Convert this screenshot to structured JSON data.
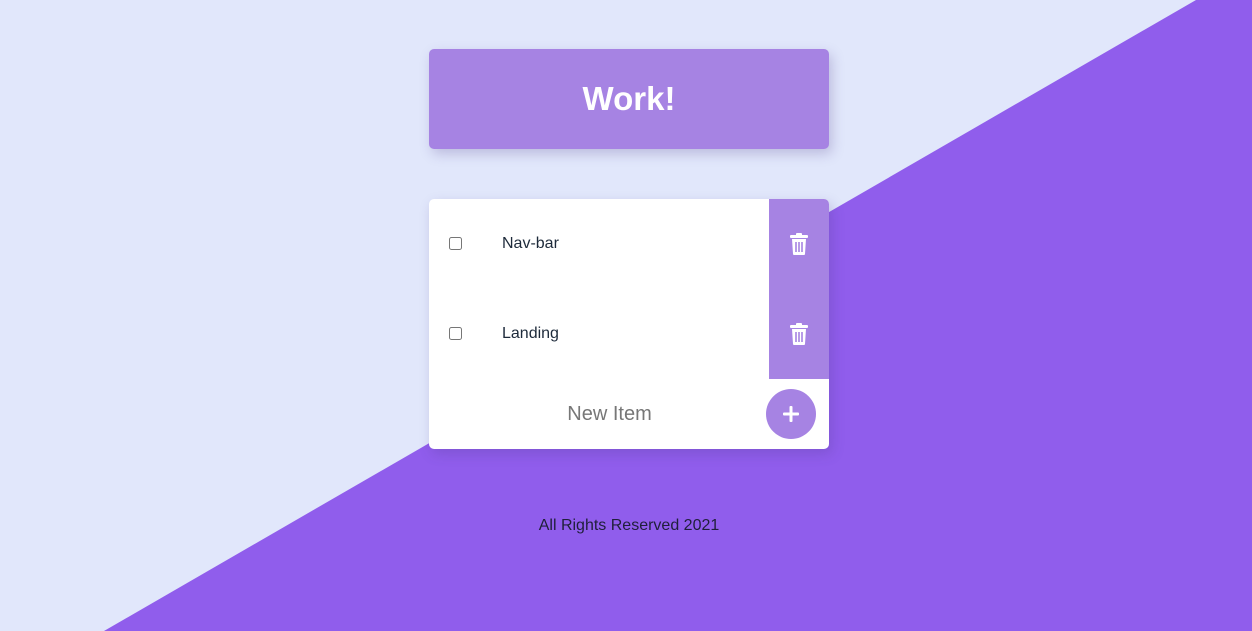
{
  "colors": {
    "background_light": "#E1E7FB",
    "background_purple": "#905DEC",
    "accent": "#A683E3",
    "card": "#FFFFFF"
  },
  "header": {
    "title": "Work!"
  },
  "list": {
    "items": [
      {
        "label": "Nav-bar",
        "checked": false,
        "delete_icon": "trash-icon"
      },
      {
        "label": "Landing",
        "checked": false,
        "delete_icon": "trash-icon"
      }
    ],
    "new_item": {
      "placeholder": "New Item",
      "value": "",
      "add_label": "+"
    }
  },
  "footer": {
    "text": "All Rights Reserved 2021"
  }
}
